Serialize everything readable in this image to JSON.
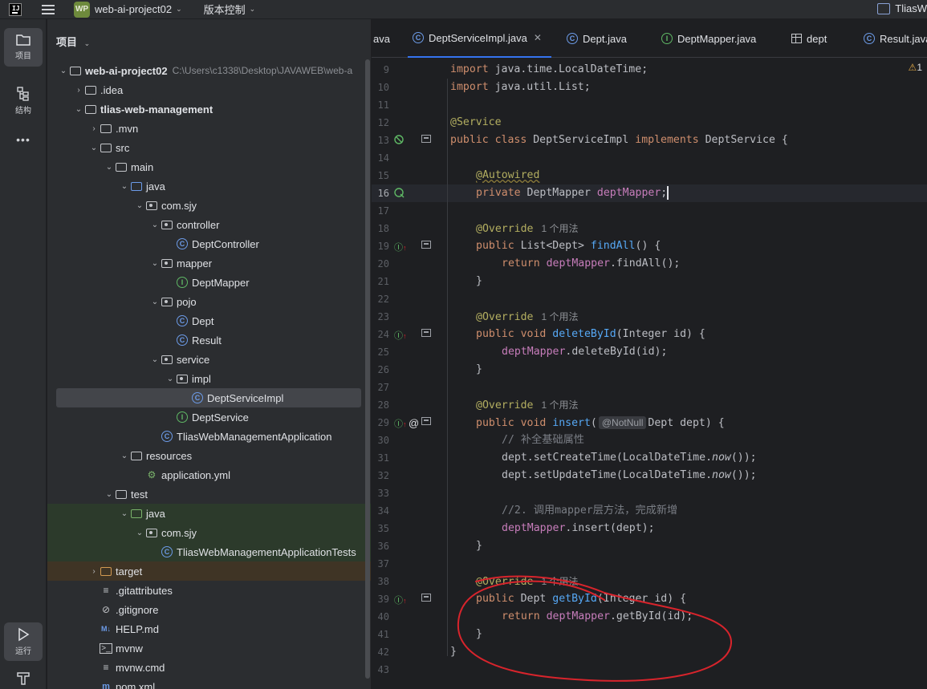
{
  "titlebar": {
    "project_badge": "WP",
    "project_name": "web-ai-project02",
    "vcs_label": "版本控制",
    "right_title": "TliasW"
  },
  "left_toolbar": {
    "project_label": "项目",
    "structure_label": "结构",
    "more_label": "•••",
    "run_label": "运行"
  },
  "project_panel": {
    "header": "项目",
    "tree": [
      {
        "label": "web-ai-project02",
        "path": "C:\\Users\\c1338\\Desktop\\JAVAWEB\\web-a",
        "depth": 0,
        "arrow": "⌄",
        "icon": "folder",
        "bold": true
      },
      {
        "label": ".idea",
        "depth": 1,
        "arrow": "›",
        "icon": "folder"
      },
      {
        "label": "tlias-web-management",
        "depth": 1,
        "arrow": "⌄",
        "icon": "folder",
        "bold": true
      },
      {
        "label": ".mvn",
        "depth": 2,
        "arrow": "›",
        "icon": "folder"
      },
      {
        "label": "src",
        "depth": 2,
        "arrow": "⌄",
        "icon": "folder"
      },
      {
        "label": "main",
        "depth": 3,
        "arrow": "⌄",
        "icon": "folder"
      },
      {
        "label": "java",
        "depth": 4,
        "arrow": "⌄",
        "icon": "folder-blue"
      },
      {
        "label": "com.sjy",
        "depth": 5,
        "arrow": "⌄",
        "icon": "package"
      },
      {
        "label": "controller",
        "depth": 6,
        "arrow": "⌄",
        "icon": "package"
      },
      {
        "label": "DeptController",
        "depth": 7,
        "arrow": "",
        "icon": "class"
      },
      {
        "label": "mapper",
        "depth": 6,
        "arrow": "⌄",
        "icon": "package"
      },
      {
        "label": "DeptMapper",
        "depth": 7,
        "arrow": "",
        "icon": "interface"
      },
      {
        "label": "pojo",
        "depth": 6,
        "arrow": "⌄",
        "icon": "package"
      },
      {
        "label": "Dept",
        "depth": 7,
        "arrow": "",
        "icon": "class"
      },
      {
        "label": "Result",
        "depth": 7,
        "arrow": "",
        "icon": "class"
      },
      {
        "label": "service",
        "depth": 6,
        "arrow": "⌄",
        "icon": "package"
      },
      {
        "label": "impl",
        "depth": 7,
        "arrow": "⌄",
        "icon": "package"
      },
      {
        "label": "DeptServiceImpl",
        "depth": 8,
        "arrow": "",
        "icon": "class",
        "selected": true
      },
      {
        "label": "DeptService",
        "depth": 7,
        "arrow": "",
        "icon": "interface"
      },
      {
        "label": "TliasWebManagementApplication",
        "depth": 6,
        "arrow": "",
        "icon": "class"
      },
      {
        "label": "resources",
        "depth": 4,
        "arrow": "⌄",
        "icon": "folder"
      },
      {
        "label": "application.yml",
        "depth": 5,
        "arrow": "",
        "icon": "yml"
      },
      {
        "label": "test",
        "depth": 3,
        "arrow": "⌄",
        "icon": "folder"
      },
      {
        "label": "java",
        "depth": 4,
        "arrow": "⌄",
        "icon": "folder-green",
        "bg": "green"
      },
      {
        "label": "com.sjy",
        "depth": 5,
        "arrow": "⌄",
        "icon": "package",
        "bg": "green"
      },
      {
        "label": "TliasWebManagementApplicationTests",
        "depth": 6,
        "arrow": "",
        "icon": "class",
        "bg": "green"
      },
      {
        "label": "target",
        "depth": 2,
        "arrow": "›",
        "icon": "folder-orange",
        "bg": "brown"
      },
      {
        "label": ".gitattributes",
        "depth": 2,
        "arrow": "",
        "icon": "text"
      },
      {
        "label": ".gitignore",
        "depth": 2,
        "arrow": "",
        "icon": "ignore"
      },
      {
        "label": "HELP.md",
        "depth": 2,
        "arrow": "",
        "icon": "md"
      },
      {
        "label": "mvnw",
        "depth": 2,
        "arrow": "",
        "icon": "terminal"
      },
      {
        "label": "mvnw.cmd",
        "depth": 2,
        "arrow": "",
        "icon": "text"
      },
      {
        "label": "pom.xml",
        "depth": 2,
        "arrow": "",
        "icon": "maven"
      }
    ]
  },
  "editor": {
    "tabs": [
      {
        "label": "ava",
        "icon": "none"
      },
      {
        "label": "DeptServiceImpl.java",
        "icon": "class",
        "active": true,
        "close": "✕"
      },
      {
        "label": "Dept.java",
        "icon": "class"
      },
      {
        "label": "DeptMapper.java",
        "icon": "interface"
      },
      {
        "label": "dept",
        "icon": "table"
      },
      {
        "label": "Result.java",
        "icon": "class"
      }
    ],
    "warning_count": "1",
    "usage_hint": "1 个用法",
    "notnull_hint": "@NotNull",
    "line_numbers": [
      "9",
      "10",
      "11",
      "12",
      "13",
      "14",
      "15",
      "16",
      "17",
      "18",
      "19",
      "20",
      "21",
      "22",
      "23",
      "24",
      "25",
      "26",
      "27",
      "28",
      "29",
      "30",
      "31",
      "32",
      "33",
      "34",
      "35",
      "36",
      "37",
      "38",
      "39",
      "40",
      "41",
      "42",
      "43"
    ],
    "current_line": "16",
    "code_strings": {
      "import1": "java.time.LocalDateTime;",
      "import2": "java.util.List;",
      "service_ann": "@Service",
      "class_name": "DeptServiceImpl",
      "iface_name": "DeptService",
      "autowired": "@Autowired",
      "mapper_type": "DeptMapper",
      "mapper_field": "deptMapper",
      "override": "@Override",
      "findAll": "findAll",
      "deleteById": "deleteById",
      "insert": "insert",
      "getById": "getById",
      "comment1": "// 补全基础属性",
      "comment2": "//2. 调用mapper层方法，完成新增",
      "setCreate": "dept.setCreateTime(LocalDateTime.",
      "setUpdate": "dept.setUpdateTime(LocalDateTime.",
      "now": "now",
      "now_tail": "());"
    }
  },
  "colors": {
    "keyword": "#cf8e6d",
    "annotation": "#b3ae60",
    "field": "#c77dbb",
    "method": "#56a8f5",
    "comment": "#7a7e85",
    "annotation_circle": "#d8242c"
  }
}
